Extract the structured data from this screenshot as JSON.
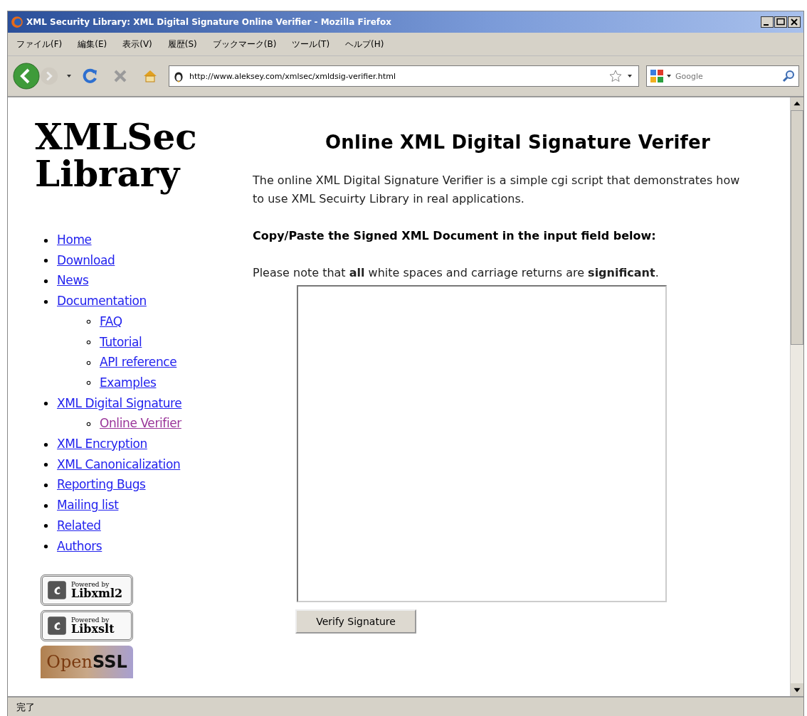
{
  "window": {
    "title": "XML Security Library: XML Digital Signature Online Verifier - Mozilla Firefox"
  },
  "menu": [
    "ファイル(F)",
    "編集(E)",
    "表示(V)",
    "履歴(S)",
    "ブックマーク(B)",
    "ツール(T)",
    "ヘルプ(H)"
  ],
  "toolbar": {
    "url": "http://www.aleksey.com/xmlsec/xmldsig-verifier.html",
    "search": {
      "placeholder": "Google"
    }
  },
  "sidebar": {
    "logo": [
      "XMLSec",
      "Library"
    ],
    "nav": [
      {
        "label": "Home",
        "selected": false
      },
      {
        "label": "Download",
        "selected": false
      },
      {
        "label": "News",
        "selected": false
      },
      {
        "label": "Documentation",
        "selected": false,
        "children": [
          {
            "label": "FAQ",
            "selected": false
          },
          {
            "label": "Tutorial",
            "selected": false
          },
          {
            "label": "API reference",
            "selected": false
          },
          {
            "label": "Examples",
            "selected": false
          }
        ]
      },
      {
        "label": "XML Digital Signature",
        "selected": false,
        "children": [
          {
            "label": "Online Verifier",
            "selected": true
          }
        ]
      },
      {
        "label": "XML Encryption",
        "selected": false
      },
      {
        "label": "XML Canonicalization",
        "selected": false
      },
      {
        "label": "Reporting Bugs",
        "selected": false
      },
      {
        "label": "Mailing list",
        "selected": false
      },
      {
        "label": "Related",
        "selected": false
      },
      {
        "label": "Authors",
        "selected": false
      }
    ],
    "badges": [
      {
        "kind": "powered",
        "top": "Powered by",
        "name": "Libxml2"
      },
      {
        "kind": "powered",
        "top": "Powered by",
        "name": "Libxslt"
      },
      {
        "kind": "openssl",
        "name": "Open**SSL**"
      }
    ]
  },
  "main": {
    "title": "Online XML Digital Signature Verifer",
    "intro": "The online XML Digital Signature Verifier is a simple cgi script that demonstrates how to use XML Secuirty Library in real applications.",
    "instruction": "Copy/Paste the Signed XML Document in the input field below:",
    "note": "Please note that **all** white spaces and carriage returns are **significant**.",
    "button": "Verify Signature"
  },
  "status_bar": "完了"
}
